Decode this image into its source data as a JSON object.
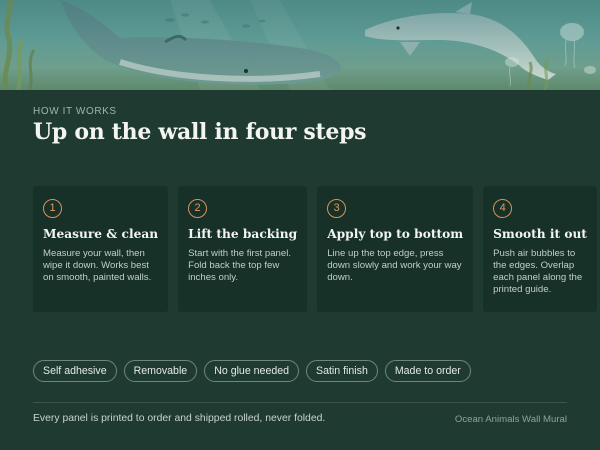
{
  "hero": {
    "image": "ocean-whale-dolphin-mural-illustration"
  },
  "section": {
    "eyebrow": "HOW IT WORKS",
    "title": "Up on the wall in four steps"
  },
  "steps": [
    {
      "number": "1",
      "title": "Measure & clean",
      "body": "Measure your wall, then wipe it down. Works best on smooth, painted walls."
    },
    {
      "number": "2",
      "title": "Lift the backing",
      "body": "Start with the first panel. Fold back the top few inches only."
    },
    {
      "number": "3",
      "title": "Apply top to bottom",
      "body": "Line up the top edge, press down slowly and work your way down."
    },
    {
      "number": "4",
      "title": "Smooth it out",
      "body": "Push air bubbles to the edges. Overlap each panel along the printed guide."
    }
  ],
  "features": [
    "Self adhesive",
    "Removable",
    "No glue needed",
    "Satin finish",
    "Made to order"
  ],
  "footer": {
    "note": "Every panel is printed to order and shipped rolled, never folded.",
    "brand": "Ocean Animals Wall Mural"
  },
  "colors": {
    "background": "#1f3b31",
    "card": "#173128",
    "accent": "#d7935c",
    "chip_border": "#6e877b"
  }
}
